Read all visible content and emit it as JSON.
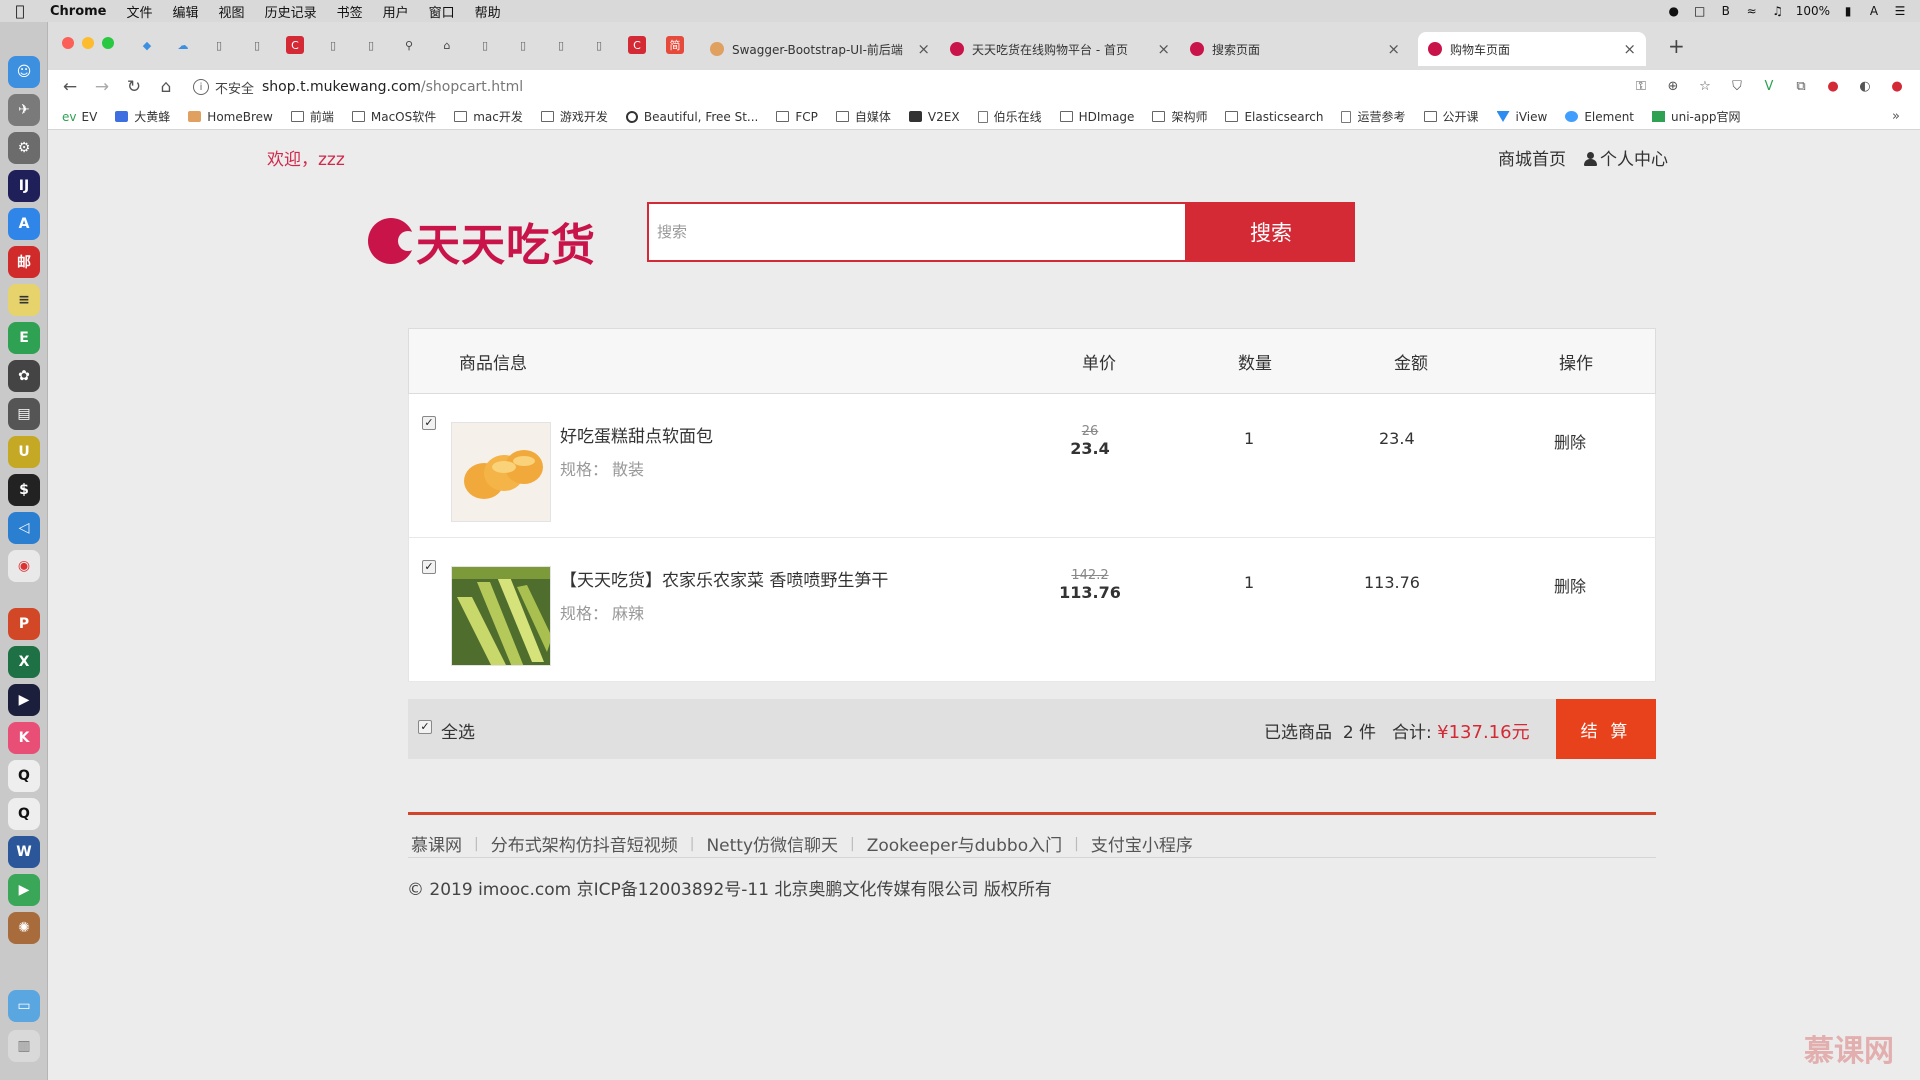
{
  "menubar": {
    "app": "Chrome",
    "items": [
      "文件",
      "编辑",
      "视图",
      "历史记录",
      "书签",
      "用户",
      "窗口",
      "帮助"
    ],
    "battery": "100%"
  },
  "tabs": [
    {
      "label": "Swagger-Bootstrap-UI-前后端",
      "favicon_color": "#e0a060",
      "active": false
    },
    {
      "label": "天天吃货在线购物平台 - 首页",
      "favicon_color": "#c9144a",
      "active": false
    },
    {
      "label": "搜索页面",
      "favicon_color": "#c9144a",
      "active": false
    },
    {
      "label": "购物车页面",
      "favicon_color": "#c9144a",
      "active": true
    }
  ],
  "address": {
    "security": "不安全",
    "host": "shop.t.mukewang.com",
    "path": "/shopcart.html"
  },
  "bookmarks": [
    "EV",
    "大黄蜂",
    "HomeBrew",
    "前端",
    "MacOS软件",
    "mac开发",
    "游戏开发",
    "Beautiful, Free St...",
    "FCP",
    "自媒体",
    "V2EX",
    "伯乐在线",
    "HDImage",
    "架构师",
    "Elasticsearch",
    "运营参考",
    "公开课",
    "iView",
    "Element",
    "uni-app官网"
  ],
  "page": {
    "welcome": "欢迎，zzz",
    "nav": {
      "home": "商城首页",
      "user_center": "个人中心"
    },
    "logo_text": "天天吃货",
    "search": {
      "placeholder": "搜索",
      "button": "搜索"
    },
    "cart": {
      "headers": {
        "info": "商品信息",
        "price": "单价",
        "qty": "数量",
        "amount": "金额",
        "ops": "操作"
      },
      "items": [
        {
          "name": "好吃蛋糕甜点软面包",
          "spec_label": "规格：",
          "spec": "散装",
          "old_price": "26",
          "price": "23.4",
          "qty": "1",
          "amount": "23.4",
          "action": "删除",
          "checked": true
        },
        {
          "name": "【天天吃货】农家乐农家菜 香喷喷野生笋干",
          "spec_label": "规格：",
          "spec": "麻辣",
          "old_price": "142.2",
          "price": "113.76",
          "qty": "1",
          "amount": "113.76",
          "action": "删除",
          "checked": true
        }
      ],
      "footer": {
        "select_all": "全选",
        "selected_label": "已选商品",
        "selected_count": "2",
        "selected_unit": "件",
        "total_label": "合计:",
        "total": "¥137.16元",
        "checkout": "结 算"
      }
    },
    "footer_links": [
      "慕课网",
      "分布式架构仿抖音短视频",
      "Netty仿微信聊天",
      "Zookeeper与dubbo入门",
      "支付宝小程序"
    ],
    "copyright": "© 2019 imooc.com 京ICP备12003892号-11 北京奥鹏文化传媒有限公司 版权所有",
    "watermark": "慕课网"
  }
}
